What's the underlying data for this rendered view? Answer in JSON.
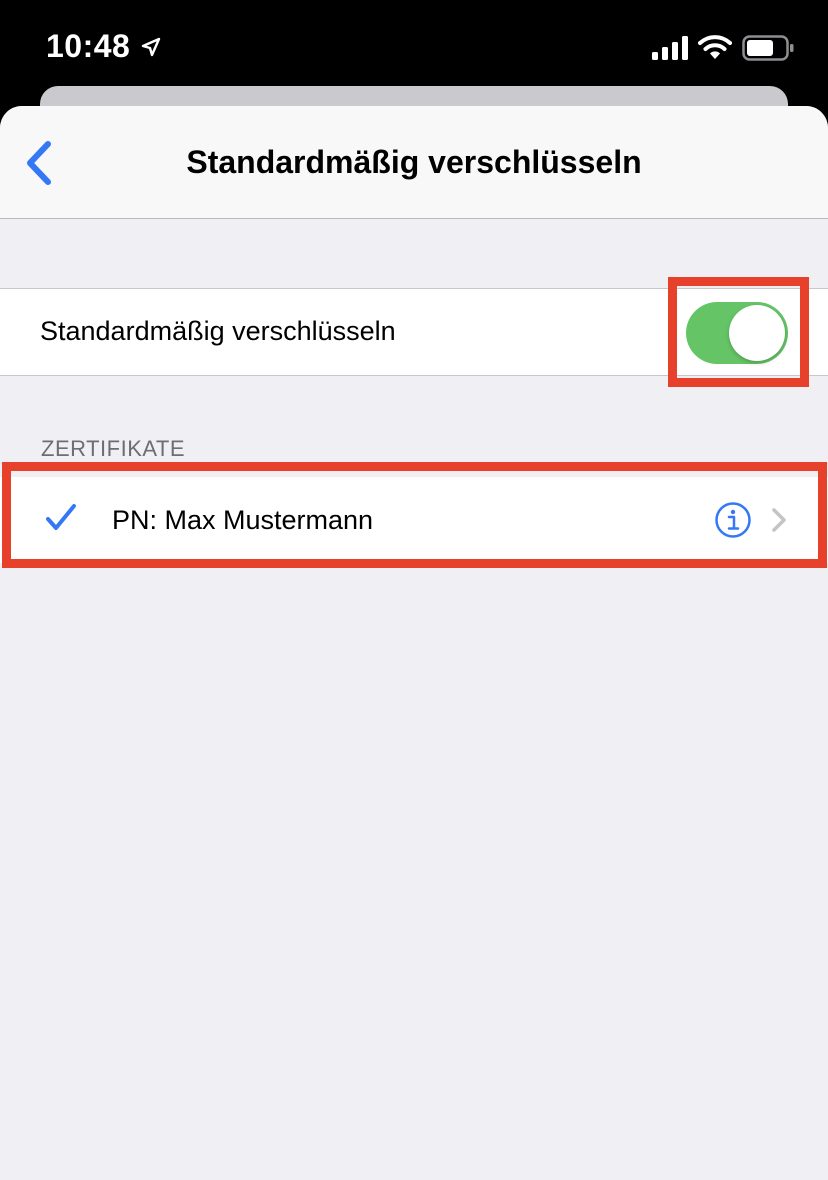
{
  "status_bar": {
    "time": "10:48",
    "location_icon": "location-arrow-icon",
    "signal_icon": "cellular-signal-icon",
    "wifi_icon": "wifi-icon",
    "battery_icon": "battery-icon"
  },
  "navbar": {
    "back_icon": "chevron-left-icon",
    "title": "Standardmäßig verschlüsseln"
  },
  "settings": {
    "encrypt_default": {
      "label": "Standardmäßig verschlüsseln",
      "enabled": true
    },
    "certificates_header": "ZERTIFIKATE",
    "certificates": [
      {
        "name": "PN: Max Mustermann",
        "selected": true
      }
    ]
  },
  "colors": {
    "accent": "#3478f6",
    "toggle_on": "#65c466",
    "highlight": "#e8412b",
    "background": "#efeff4"
  }
}
